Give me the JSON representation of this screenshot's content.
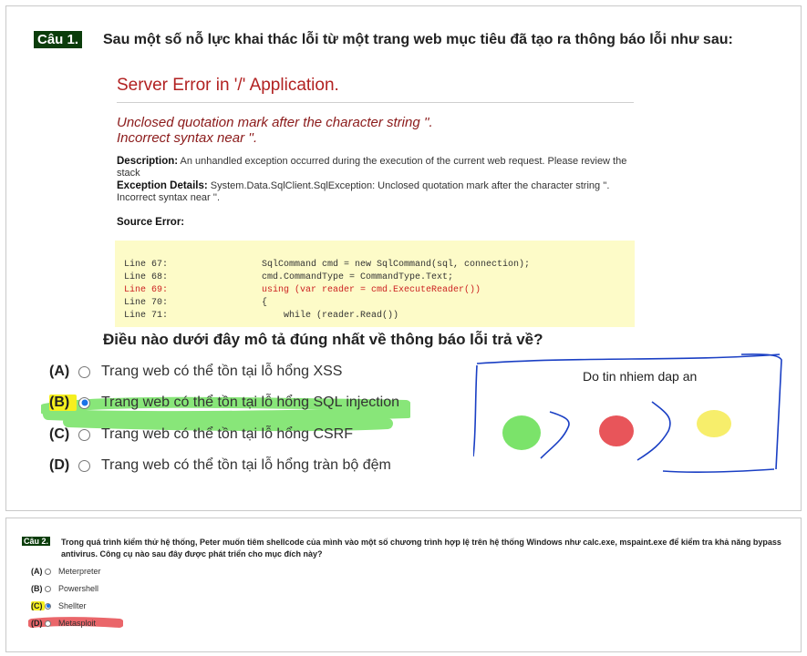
{
  "question1": {
    "badge": "Câu 1.",
    "text": "Sau một số nỗ lực khai thác lỗi từ một trang web mục tiêu đã tạo ra thông báo lỗi như sau:",
    "error_image": {
      "title": "Server Error in '/' Application.",
      "message_line1": "Unclosed quotation mark after the character string ''.",
      "message_line2": "Incorrect syntax near ''.",
      "description_label": "Description:",
      "description_text": "An unhandled exception occurred during the execution of the current web request. Please review the stack",
      "exception_label": "Exception Details:",
      "exception_text": "System.Data.SqlClient.SqlException: Unclosed quotation mark after the character string ''.",
      "exception_text2": "Incorrect syntax near ''.",
      "source_label": "Source Error:",
      "code_lines": [
        {
          "line": "Line 67:",
          "code": "SqlCommand cmd = new SqlCommand(sql, connection);"
        },
        {
          "line": "Line 68:",
          "code": "cmd.CommandType = CommandType.Text;"
        },
        {
          "line": "Line 69:",
          "code": "using (var reader = cmd.ExecuteReader())"
        },
        {
          "line": "Line 70:",
          "code": "{"
        },
        {
          "line": "Line 71:",
          "code": "    while (reader.Read())"
        }
      ]
    },
    "prompt": "Điều nào dưới đây mô tả đúng nhất về thông báo lỗi trả về?",
    "options": [
      {
        "letter": "(A)",
        "text": "Trang web có thể tồn tại lỗ hổng XSS",
        "selected": false
      },
      {
        "letter": "(B)",
        "text": "Trang web có thể tồn tại lỗ hổng SQL injection",
        "selected": true
      },
      {
        "letter": "(C)",
        "text": "Trang web có thể tồn tại lỗ hổng CSRF",
        "selected": false
      },
      {
        "letter": "(D)",
        "text": "Trang web có thể tồn tại lỗ hổng tràn bộ đệm",
        "selected": false
      }
    ],
    "annotation_note": "Do tin nhiem dap an"
  },
  "question2": {
    "badge": "Câu 2.",
    "text_line1": "Trong quá trình kiểm thử hệ thống, Peter muốn tiêm shellcode của mình vào một số chương trình hợp lệ trên hệ thống Windows như calc.exe, mspaint.exe để kiểm tra khả năng bypass",
    "text_line2": "antivirus. Công cụ nào sau đây được phát triển cho mục đích này?",
    "options": [
      {
        "letter": "(A)",
        "text": "Meterpreter",
        "selected": false
      },
      {
        "letter": "(B)",
        "text": "Powershell",
        "selected": false
      },
      {
        "letter": "(C)",
        "text": "Shellter",
        "selected": true
      },
      {
        "letter": "(D)",
        "text": "Metasploit",
        "selected": false
      }
    ]
  },
  "colors": {
    "badge_bg": "#0b3d0b",
    "radio_selected": "#1a73e8",
    "green_marker": "#7be36a",
    "red_marker": "#e8555a",
    "yellow_marker": "#f7ee6b",
    "pen_blue": "#1a3fc4",
    "error_red": "#b22222",
    "code_bg": "#fdfbc8"
  }
}
